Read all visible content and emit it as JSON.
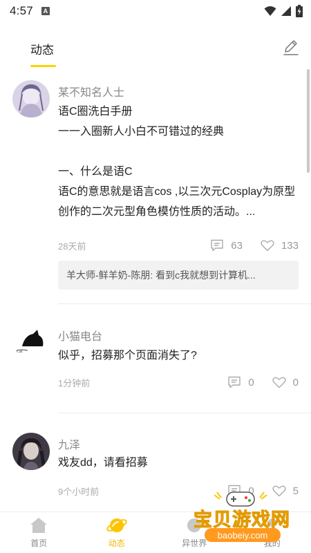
{
  "status_bar": {
    "time": "4:57",
    "notification_icon": "A"
  },
  "header": {
    "active_tab": "动态",
    "edit_icon": "edit-icon"
  },
  "posts": [
    {
      "author": "某不知名人士",
      "body": "语C圈洗白手册\n一一入圈新人小白不可错过的经典\n\n一、什么是语C\n语C的意思就是语言cos ,以三次元Cosplay为原型创作的二次元型角色模仿性质的活动。...",
      "time": "28天前",
      "comments": "63",
      "likes": "133",
      "preview_comment": "羊大师-鲜羊奶-陈朋: 看到c我就想到计算机..."
    },
    {
      "author": "小猫电台",
      "body": "似乎，招募那个页面消失了?",
      "time": "1分钟前",
      "comments": "0",
      "likes": "0"
    },
    {
      "author": "九泽",
      "body": "戏友dd，请看招募",
      "time": "9个小时前",
      "comments": "0",
      "likes": "5"
    }
  ],
  "bottom_nav": [
    {
      "label": "首页",
      "icon": "home-icon",
      "active": false
    },
    {
      "label": "动态",
      "icon": "planet-icon",
      "active": true
    },
    {
      "label": "异世界",
      "icon": "world-icon",
      "active": false
    },
    {
      "label": "我的",
      "icon": "profile-icon",
      "active": false
    }
  ],
  "watermark": {
    "title": "宝贝游戏网",
    "url": "baobeiy.com"
  },
  "colors": {
    "accent": "#FFD200",
    "accent_text": "#F2B800",
    "muted": "#999999"
  }
}
